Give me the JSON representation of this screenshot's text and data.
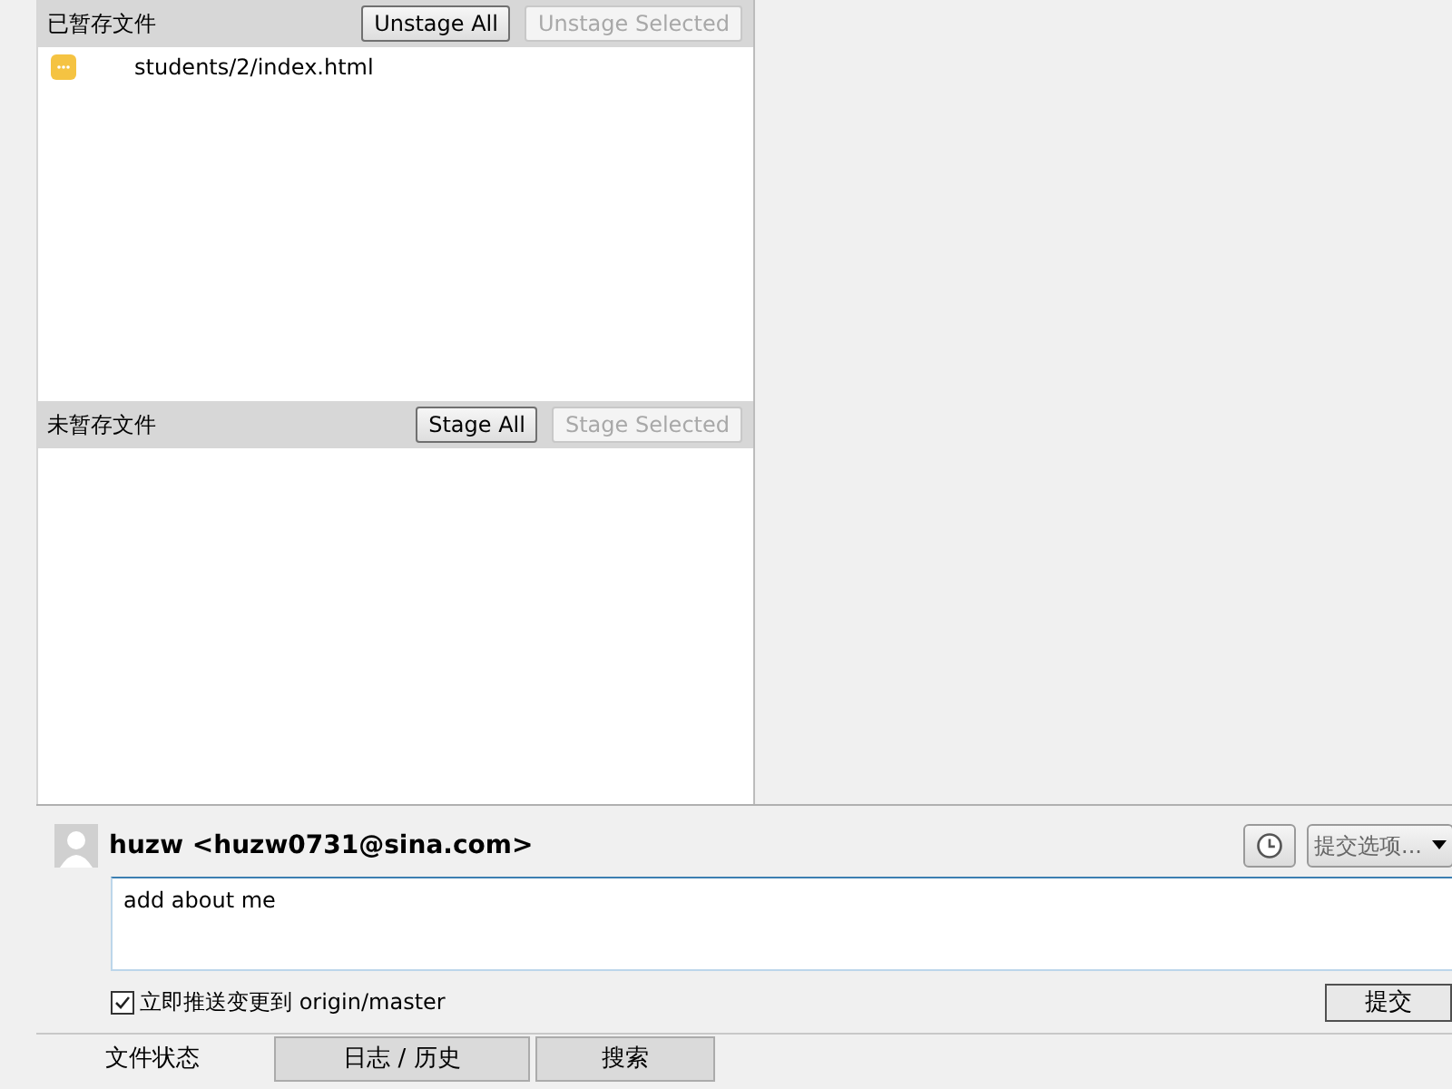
{
  "staged": {
    "title": "已暂存文件",
    "buttons": [
      {
        "label": "Unstage All",
        "disabled": false
      },
      {
        "label": "Unstage Selected",
        "disabled": true
      }
    ],
    "files": [
      {
        "path": "students/2/index.html",
        "kind": "modified"
      }
    ]
  },
  "unstaged": {
    "title": "未暂存文件",
    "buttons": [
      {
        "label": "Stage All",
        "disabled": false
      },
      {
        "label": "Stage Selected",
        "disabled": true
      }
    ]
  },
  "commit": {
    "author": "huzw <huzw0731@sina.com>",
    "options_label": "提交选项...",
    "message": "add about me",
    "push": {
      "label": "立即推送变更到 origin/master",
      "checked": true
    },
    "submit": "提交"
  },
  "tabs": [
    {
      "label": "文件状态",
      "selected": true
    },
    {
      "label": "日志 / 历史",
      "selected": false
    },
    {
      "label": "搜索",
      "selected": false
    }
  ]
}
